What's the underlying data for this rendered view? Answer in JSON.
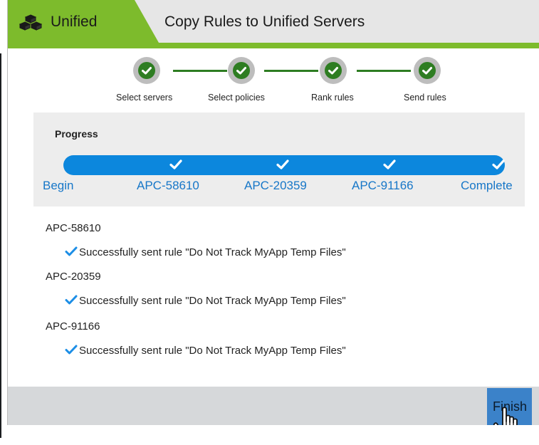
{
  "header": {
    "app_name": "Unified",
    "app_icon": "boxes-icon",
    "title": "Copy Rules to Unified Servers",
    "accent_color": "#7dbb2c"
  },
  "wizard_steps": [
    {
      "label": "Select servers",
      "status": "complete"
    },
    {
      "label": "Select policies",
      "status": "complete"
    },
    {
      "label": "Rank rules",
      "status": "complete"
    },
    {
      "label": "Send rules",
      "status": "complete"
    }
  ],
  "progress": {
    "title": "Progress",
    "stages": [
      {
        "label": "Begin",
        "done": false
      },
      {
        "label": "APC-58610",
        "done": true
      },
      {
        "label": "APC-20359",
        "done": true
      },
      {
        "label": "APC-91166",
        "done": true
      },
      {
        "label": "Complete",
        "done": true
      }
    ],
    "fraction": 1.0,
    "bar_color": "#0c87dd"
  },
  "results": [
    {
      "server": "APC-58610",
      "message": "Successfully sent rule \"Do Not Track MyApp Temp Files\""
    },
    {
      "server": "APC-20359",
      "message": "Successfully sent rule \"Do Not Track MyApp Temp Files\""
    },
    {
      "server": "APC-91166",
      "message": "Successfully sent rule \"Do Not Track MyApp Temp Files\""
    }
  ],
  "footer": {
    "finish_label": "Finish"
  }
}
